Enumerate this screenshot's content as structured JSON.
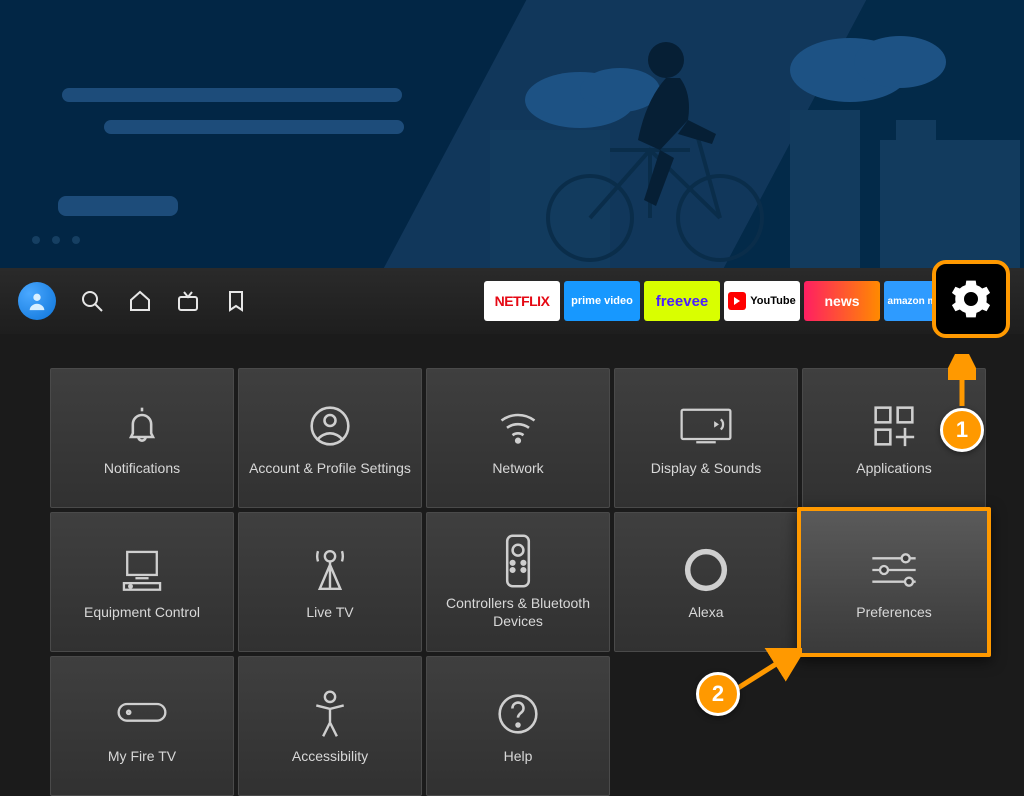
{
  "nav": {
    "apps": {
      "netflix": "NETFLIX",
      "primevideo": "prime video",
      "freevee": "freevee",
      "youtube": "YouTube",
      "news": "news",
      "amazonmusic": "amazon music"
    }
  },
  "settings": {
    "row1": [
      {
        "id": "notifications",
        "label": "Notifications"
      },
      {
        "id": "account",
        "label": "Account & Profile Settings"
      },
      {
        "id": "network",
        "label": "Network"
      },
      {
        "id": "display",
        "label": "Display & Sounds"
      },
      {
        "id": "applications",
        "label": "Applications"
      }
    ],
    "row2": [
      {
        "id": "equipment",
        "label": "Equipment Control"
      },
      {
        "id": "livetv",
        "label": "Live TV"
      },
      {
        "id": "controllers",
        "label": "Controllers & Bluetooth Devices"
      },
      {
        "id": "alexa",
        "label": "Alexa"
      },
      {
        "id": "preferences",
        "label": "Preferences"
      }
    ],
    "row3": [
      {
        "id": "myfiretv",
        "label": "My Fire TV"
      },
      {
        "id": "accessibility",
        "label": "Accessibility"
      },
      {
        "id": "help",
        "label": "Help"
      }
    ]
  },
  "annotations": {
    "step1": "1",
    "step2": "2"
  }
}
